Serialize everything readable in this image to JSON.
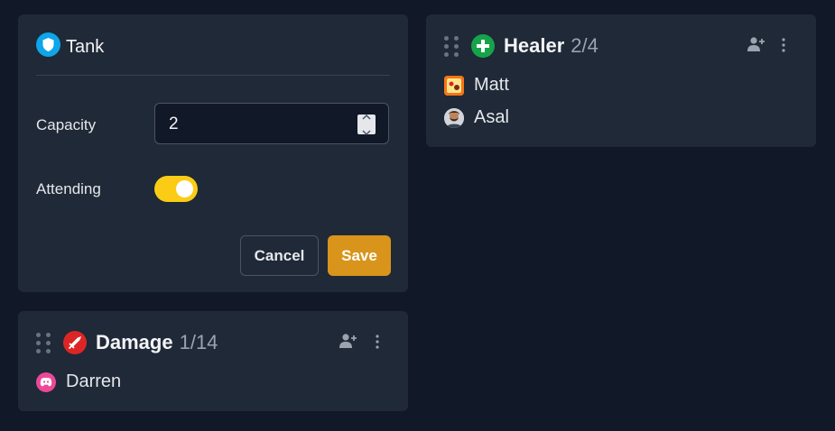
{
  "tank": {
    "title": "Tank",
    "capacity_label": "Capacity",
    "capacity_value": "2",
    "attending_label": "Attending",
    "attending": true,
    "cancel_label": "Cancel",
    "save_label": "Save"
  },
  "healer": {
    "name": "Healer",
    "count": "2/4",
    "members": [
      {
        "name": "Matt",
        "avatar": "game-avatar"
      },
      {
        "name": "Asal",
        "avatar": "bearded-avatar"
      }
    ]
  },
  "damage": {
    "name": "Damage",
    "count": "1/14",
    "members": [
      {
        "name": "Darren",
        "avatar": "discord-icon"
      }
    ]
  },
  "colors": {
    "background": "#111827",
    "card": "#1f2937",
    "tank": "#0ea5e9",
    "healer": "#16a34a",
    "damage": "#dc2626",
    "toggle": "#facc15",
    "save": "#d9941b",
    "discord": "#ec4899"
  }
}
